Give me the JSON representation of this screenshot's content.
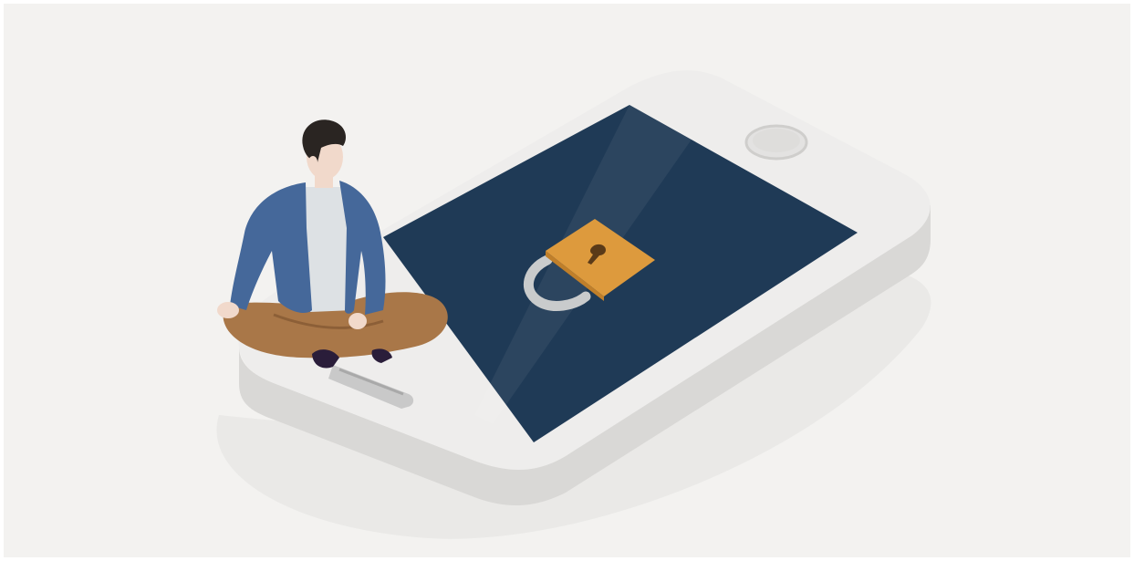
{
  "colors": {
    "background": "#f3f2f0",
    "phone_body": "#eeedec",
    "phone_edge": "#d9d8d6",
    "screen": "#1f3a56",
    "padlock_body": "#dd9a3d",
    "padlock_shackle": "#c9cbcc",
    "jacket": "#45689a",
    "shirt": "#dde1e4",
    "pants": "#a97748",
    "hair": "#2a2522",
    "skin": "#f1d9cb",
    "key": "#c9c9c9"
  },
  "illustration": {
    "subject": "person-sitting-on-locked-phone",
    "icons": [
      "padlock-icon",
      "key-icon",
      "home-button"
    ]
  }
}
